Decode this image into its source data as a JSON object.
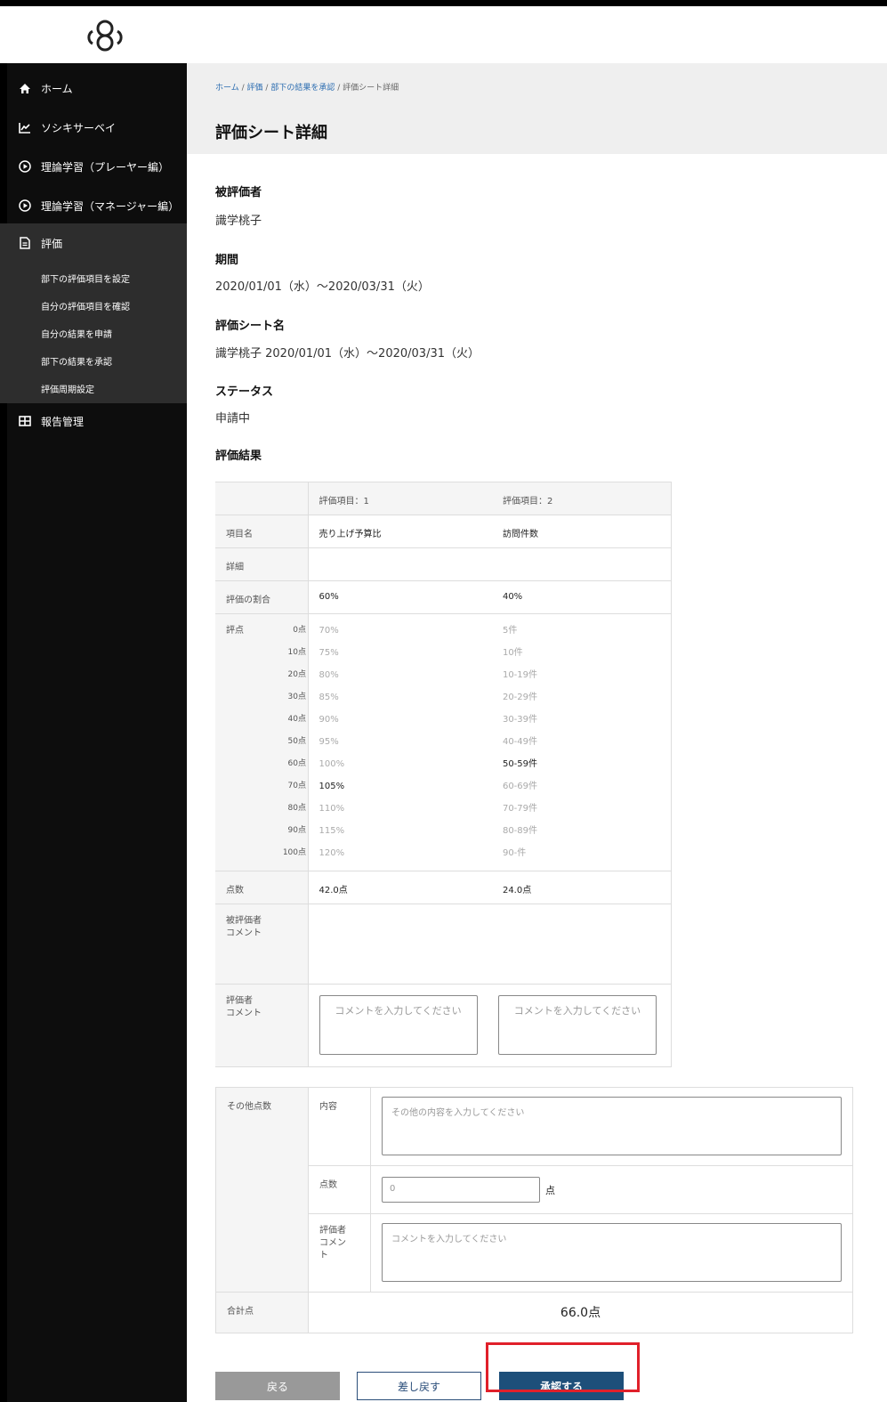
{
  "nav": {
    "items": [
      {
        "label": "ホーム",
        "icon": "home-icon"
      },
      {
        "label": "ソシキサーベイ",
        "icon": "chart-icon"
      },
      {
        "label": "理論学習（プレーヤー編）",
        "icon": "play-icon"
      },
      {
        "label": "理論学習（マネージャー編）",
        "icon": "play-icon"
      },
      {
        "label": "評価",
        "icon": "document-icon"
      },
      {
        "label": "報告管理",
        "icon": "grid-icon"
      }
    ],
    "sub_items": [
      "部下の評価項目を設定",
      "自分の評価項目を確認",
      "自分の結果を申請",
      "部下の結果を承認",
      "評価周期設定"
    ]
  },
  "breadcrumb": {
    "home": "ホーム",
    "eval": "評価",
    "approve": "部下の結果を承認",
    "current": "評価シート詳細",
    "sep": "/"
  },
  "page_title": "評価シート詳細",
  "fields": {
    "evaluatee_label": "被評価者",
    "evaluatee": "識学桃子",
    "period_label": "期間",
    "period": "2020/01/01（水）～2020/03/31（火）",
    "sheet_label": "評価シート名",
    "sheet": "識学桃子 2020/01/01（水）～2020/03/31（火）",
    "status_label": "ステータス",
    "status": "申請中",
    "result_label": "評価結果"
  },
  "result_table": {
    "col1": "評価項目：1",
    "col2": "評価項目：2",
    "row_name_label": "項目名",
    "name1": "売り上げ予算比",
    "name2": "訪問件数",
    "row_detail_label": "詳細",
    "row_ratio_label": "評価の割合",
    "ratio1": "60%",
    "ratio2": "40%",
    "row_points_label": "評点",
    "points": [
      "0点",
      "10点",
      "20点",
      "30点",
      "40点",
      "50点",
      "60点",
      "70点",
      "80点",
      "90点",
      "100点"
    ],
    "item1_levels": [
      "70%",
      "75%",
      "80%",
      "85%",
      "90%",
      "95%",
      "100%",
      "105%",
      "110%",
      "115%",
      "120%"
    ],
    "item2_levels": [
      "5件",
      "10件",
      "10-19件",
      "20-29件",
      "30-39件",
      "40-49件",
      "50-59件",
      "60-69件",
      "70-79件",
      "80-89件",
      "90-件"
    ],
    "item1_selected_index": 7,
    "item2_selected_index": 6,
    "row_score_label": "点数",
    "score1": "42.0点",
    "score2": "24.0点",
    "row_evaluatee_comment_label_1": "被評価者",
    "row_evaluatee_comment_label_2": "コメント",
    "row_evaluator_comment_label_1": "評価者",
    "row_evaluator_comment_label_2": "コメント",
    "comment_placeholder": "コメントを入力してください"
  },
  "other_table": {
    "label": "その他点数",
    "content_label": "内容",
    "content_placeholder": "その他の内容を入力してください",
    "score_label": "点数",
    "score_value": "0",
    "score_unit": "点",
    "evaluator_comment_label_1": "評価者",
    "evaluator_comment_label_2": "コメン",
    "evaluator_comment_label_3": "ト",
    "comment_placeholder": "コメントを入力してください",
    "total_label": "合計点",
    "total_value": "66.0点"
  },
  "buttons": {
    "back": "戻る",
    "return": "差し戻す",
    "approve": "承認する"
  }
}
